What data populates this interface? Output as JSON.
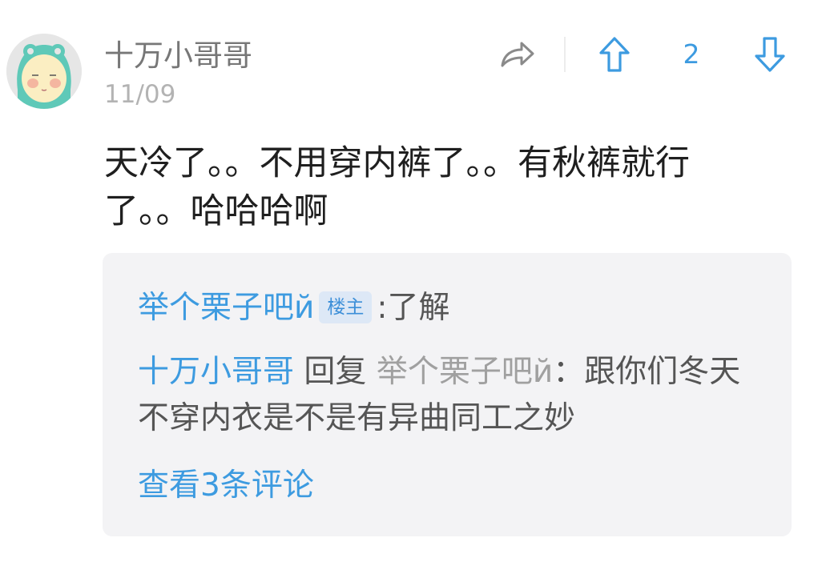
{
  "post": {
    "author": "十万小哥哥",
    "date": "11/09",
    "vote_count": "2",
    "text": "天冷了。。不用穿内裤了。。有秋裤就行了。。哈哈哈啊"
  },
  "icons": {
    "share": "share-icon",
    "upvote": "arrow-up-icon",
    "downvote": "arrow-down-icon"
  },
  "colors": {
    "accent": "#3d9be0",
    "reply_bg": "#f3f3f5",
    "tag_bg": "#dde8f6"
  },
  "replies": [
    {
      "author": "举个栗子吧й",
      "tag": "楼主",
      "separator": ":",
      "text": "了解"
    },
    {
      "author": "十万小哥哥",
      "reply_word": "回复",
      "target": "举个栗子吧й",
      "separator": "：",
      "text": "跟你们冬天不穿内衣是不是有异曲同工之妙"
    }
  ],
  "view_more": "查看3条评论"
}
